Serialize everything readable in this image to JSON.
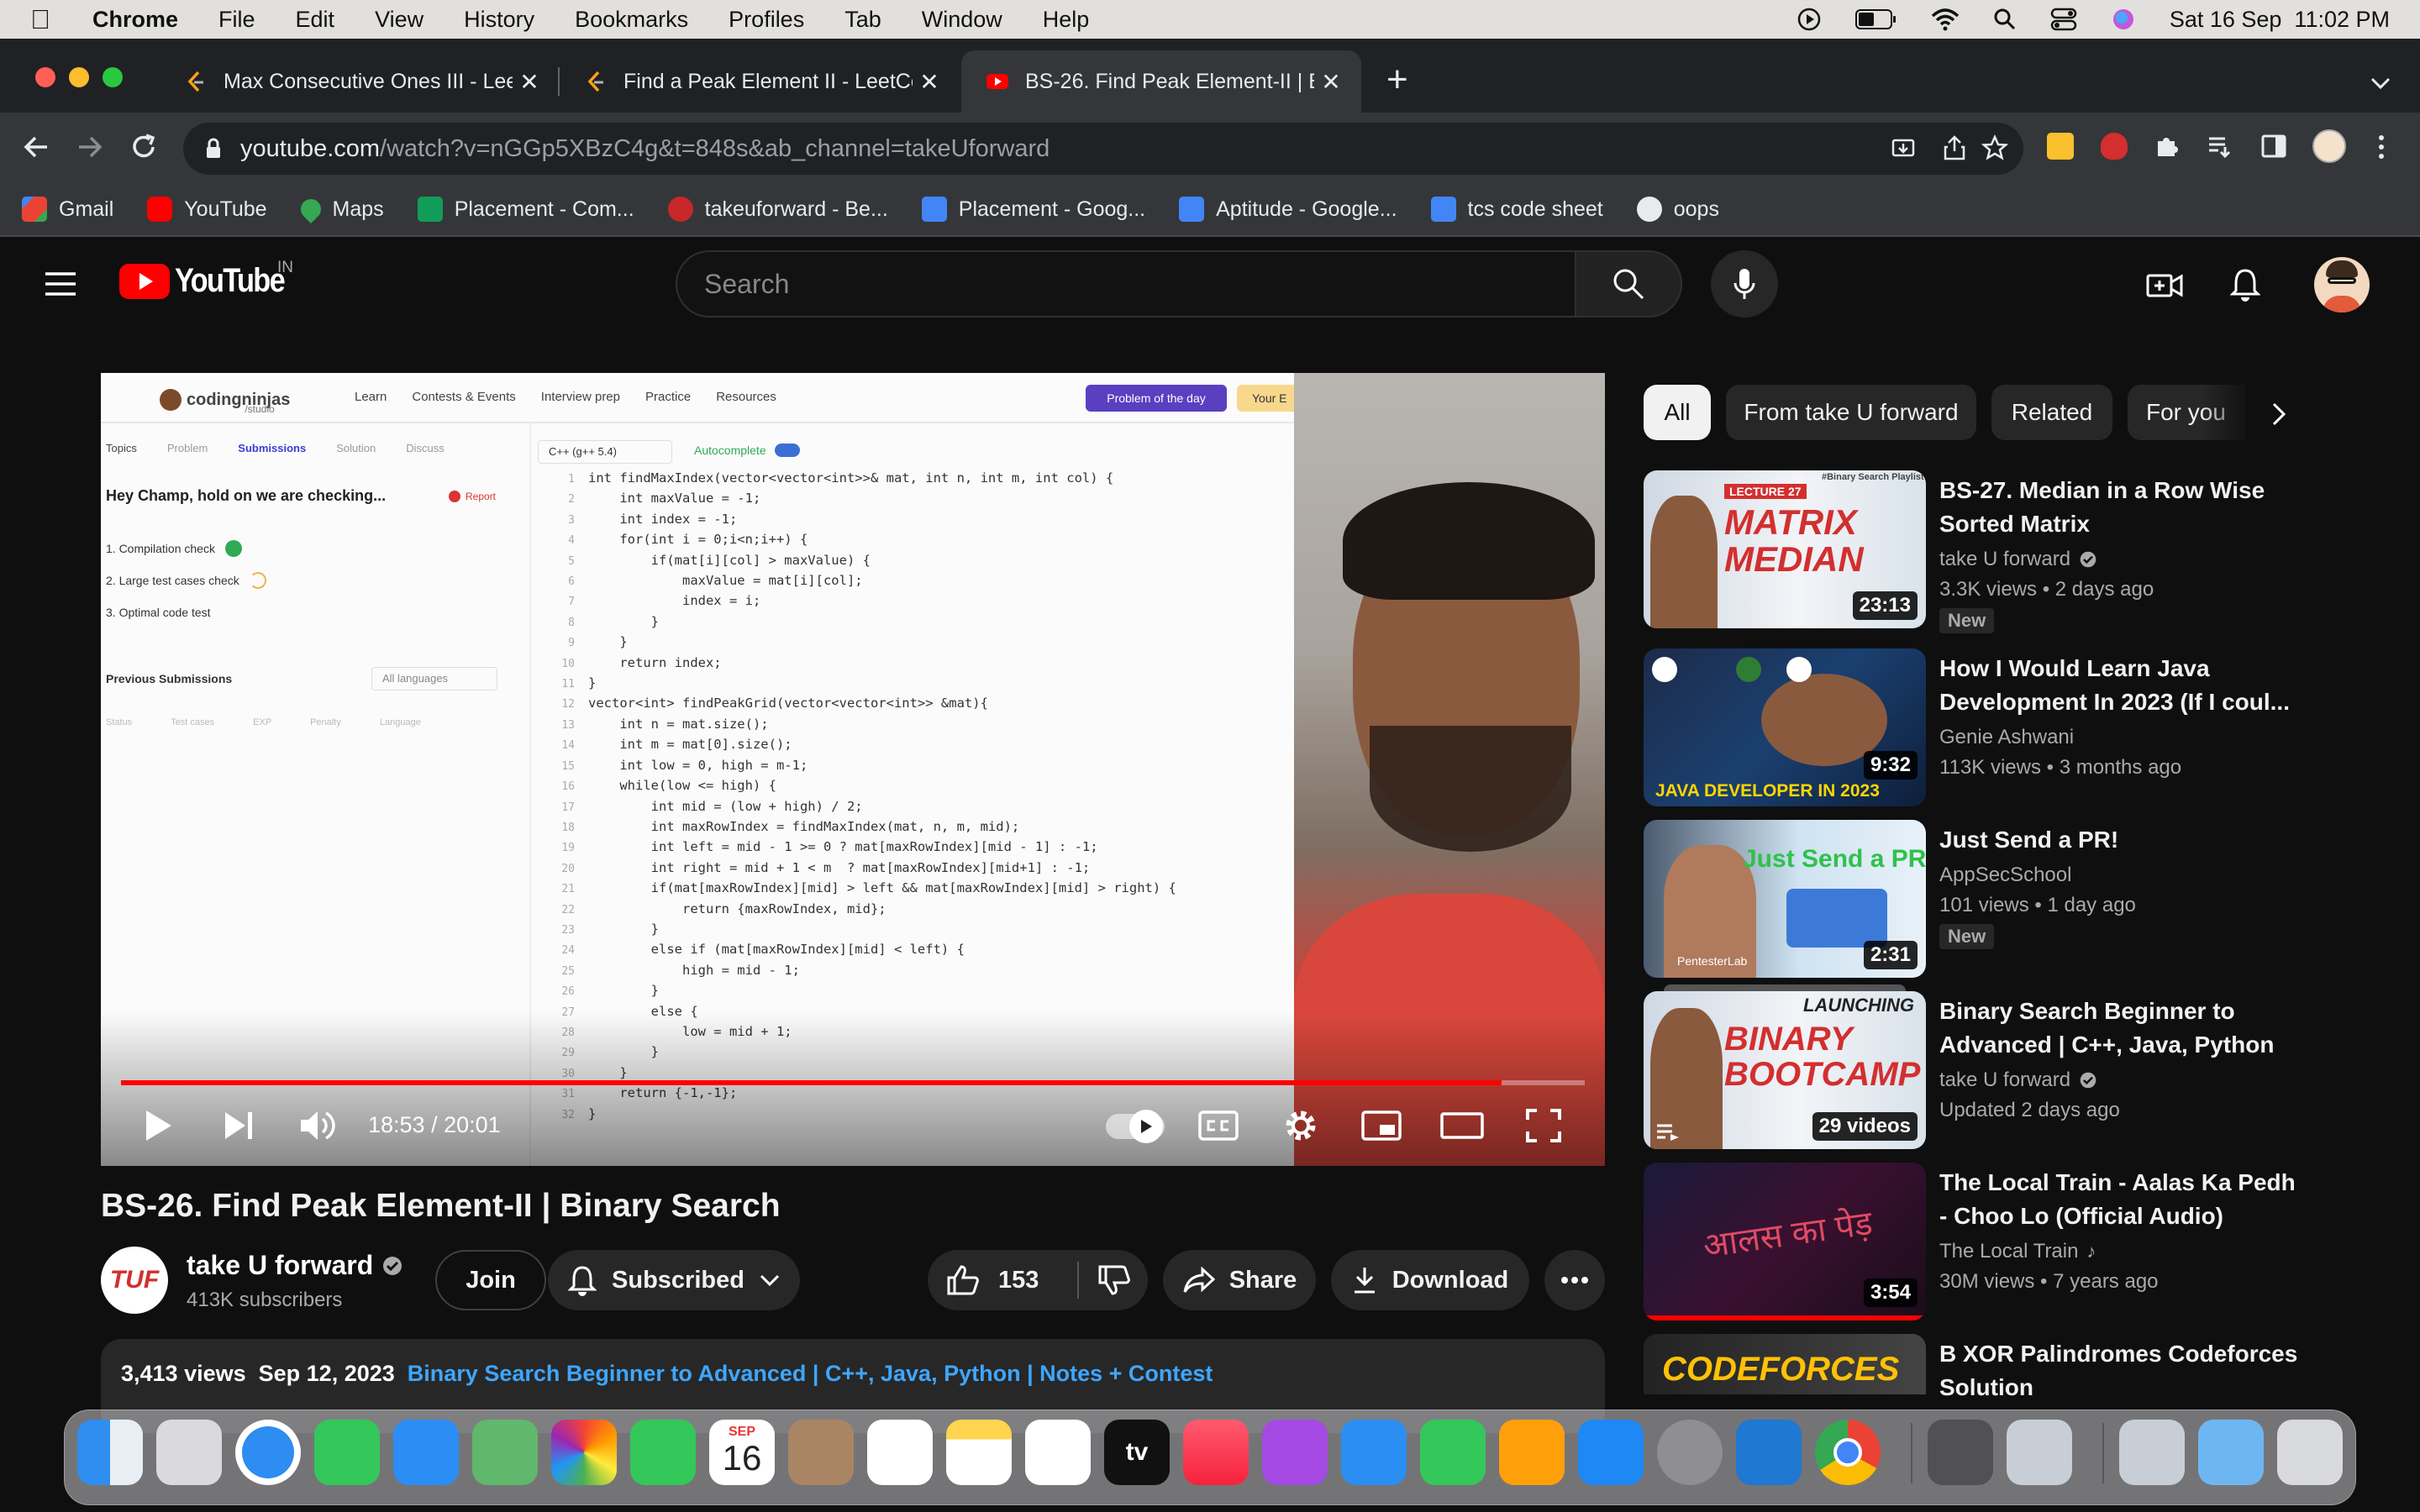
{
  "menubar": {
    "apple": "",
    "app": "Chrome",
    "items": [
      "File",
      "Edit",
      "View",
      "History",
      "Bookmarks",
      "Profiles",
      "Tab",
      "Window",
      "Help"
    ],
    "datetime": "Sat 16 Sep  11:02 PM"
  },
  "tabs": [
    {
      "title": "Max Consecutive Ones III - Lee",
      "active": false
    },
    {
      "title": "Find a Peak Element II - LeetCo",
      "active": false
    },
    {
      "title": "BS-26. Find Peak Element-II | B",
      "active": true
    }
  ],
  "omnibox": {
    "host": "youtube.com",
    "rest": "/watch?v=nGGp5XBzC4g&t=848s&ab_channel=takeUforward"
  },
  "bookmarks": [
    {
      "label": "Gmail",
      "color": "#ea4335"
    },
    {
      "label": "YouTube",
      "color": "#ff0000"
    },
    {
      "label": "Maps",
      "color": "#34a853"
    },
    {
      "label": "Placement - Com...",
      "color": "#0f9d58"
    },
    {
      "label": "takeuforward - Be...",
      "color": "#c62828"
    },
    {
      "label": "Placement - Goog...",
      "color": "#4285f4"
    },
    {
      "label": "Aptitude - Google...",
      "color": "#4285f4"
    },
    {
      "label": "tcs code sheet",
      "color": "#4285f4"
    },
    {
      "label": "oops",
      "color": "#e8eaed"
    }
  ],
  "youtube": {
    "logo_text": "YouTube",
    "region": "IN",
    "search_placeholder": "Search"
  },
  "player": {
    "time": "18:53 / 20:01",
    "progress": 0.943,
    "screen": {
      "brand": "codingninjas",
      "brand_sub": "/studio",
      "nav": [
        "Learn",
        "Contests & Events",
        "Interview prep",
        "Practice",
        "Resources"
      ],
      "potd": "Problem of the day",
      "your": "Your E",
      "panel_tabs": [
        "Topics",
        "Problem",
        "Submissions",
        "Solution",
        "Discuss"
      ],
      "checking": "Hey Champ, hold on we are checking...",
      "report": "Report",
      "checks": [
        "1. Compilation check",
        "2. Large test cases check",
        "3. Optimal code test"
      ],
      "prev": "Previous Submissions",
      "all_lang": "All languages",
      "cols": [
        "Status",
        "Test cases",
        "EXP",
        "Penalty",
        "Language"
      ],
      "lang": "C++ (g++ 5.4)",
      "autocomplete": "Autocomplete",
      "code": [
        "int findMaxIndex(vector<vector<int>>& mat, int n, int m, int col) {",
        "    int maxValue = -1;",
        "    int index = -1;",
        "    for(int i = 0;i<n;i++) {",
        "        if(mat[i][col] > maxValue) {",
        "            maxValue = mat[i][col];",
        "            index = i;",
        "        }",
        "    }",
        "    return index;",
        "}",
        "vector<int> findPeakGrid(vector<vector<int>> &mat){",
        "    int n = mat.size();",
        "    int m = mat[0].size();",
        "    int low = 0, high = m-1;",
        "    while(low <= high) {",
        "        int mid = (low + high) / 2;",
        "        int maxRowIndex = findMaxIndex(mat, n, m, mid);",
        "        int left = mid - 1 >= 0 ? mat[maxRowIndex][mid - 1] : -1;",
        "        int right = mid + 1 < m  ? mat[maxRowIndex][mid+1] : -1;",
        "        if(mat[maxRowIndex][mid] > left && mat[maxRowIndex][mid] > right) {",
        "            return {maxRowIndex, mid};",
        "        }",
        "        else if (mat[maxRowIndex][mid] < left) {",
        "            high = mid - 1;",
        "        }",
        "        else {",
        "            low = mid + 1;",
        "        }",
        "    }",
        "    return {-1,-1};",
        "}"
      ]
    }
  },
  "video": {
    "title": "BS-26. Find Peak Element-II | Binary Search",
    "channel": "take U forward",
    "subscribers": "413K subscribers",
    "join": "Join",
    "subscribed": "Subscribed",
    "likes": "153",
    "share": "Share",
    "download": "Download",
    "views": "3,413 views",
    "date": "Sep 12, 2023",
    "playlist_link": "Binary Search Beginner to Advanced | C++, Java, Python | Notes + Contest"
  },
  "chips": [
    "All",
    "From take U forward",
    "Related",
    "For you"
  ],
  "recommendations": [
    {
      "title": "BS-27. Median in a Row Wise Sorted Matrix",
      "channel": "take U forward",
      "meta": "3.3K views  • 2 days ago",
      "badge": "New",
      "duration": "23:13",
      "thumb_text": "MATRIX MEDIAN",
      "thumb_tag": "LECTURE 27",
      "thumb_corner": "#Binary Search Playlist"
    },
    {
      "title": "How I Would Learn Java Development In 2023 (If I coul...",
      "channel": "Genie Ashwani",
      "meta": "113K views  • 3 months ago",
      "badge": "",
      "duration": "9:32",
      "thumb_text": "JAVA DEVELOPER IN 2023"
    },
    {
      "title": "Just Send a PR!",
      "channel": "AppSecSchool",
      "meta": "101 views  • 1 day ago",
      "badge": "New",
      "duration": "2:31",
      "thumb_text": "Just Send a PR!",
      "thumb_corner": "PentesterLab"
    },
    {
      "title": "Binary Search Beginner to Advanced | C++, Java, Python |...",
      "channel": "take U forward",
      "meta": "Updated 2 days ago",
      "badge": "",
      "duration": "29 videos",
      "thumb_text": "BINARY BOOTCAMP",
      "thumb_tag": "LAUNCHING"
    },
    {
      "title": "The Local Train - Aalas Ka Pedh - Choo Lo (Official Audio)",
      "channel": "The Local Train",
      "meta": "30M views  • 7 years ago",
      "badge": "",
      "duration": "3:54",
      "thumb_text": "आलस का पेड़"
    },
    {
      "title": "B XOR Palindromes Codeforces Solution",
      "channel": "",
      "meta": "",
      "badge": "",
      "duration": "",
      "thumb_text": "CODEFORCES"
    }
  ],
  "dock": {
    "calendar_month": "SEP",
    "calendar_day": "16",
    "tv": "tv"
  }
}
